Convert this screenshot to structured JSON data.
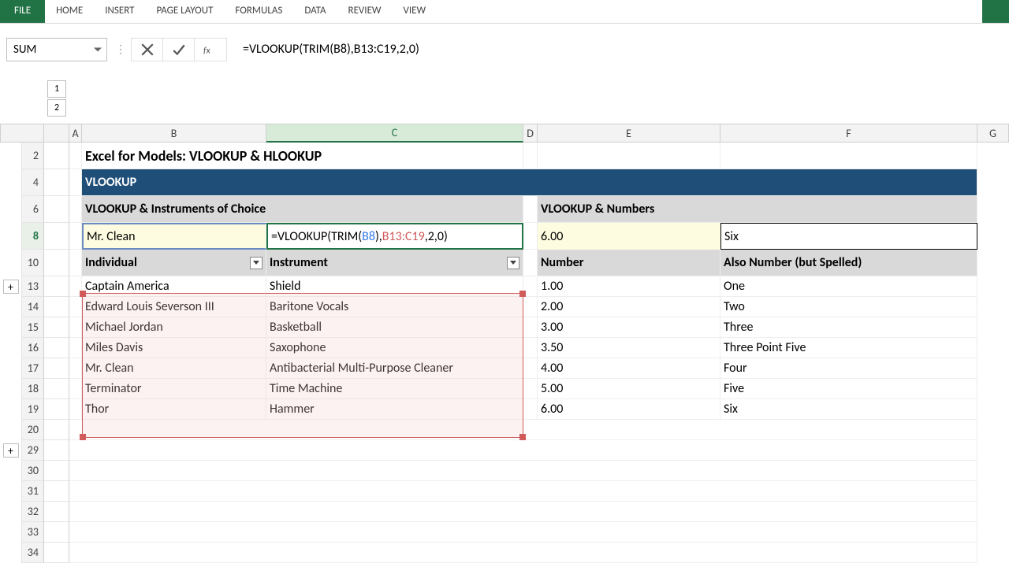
{
  "ribbon": {
    "file": "FILE",
    "tabs": [
      "HOME",
      "INSERT",
      "PAGE LAYOUT",
      "FORMULAS",
      "DATA",
      "REVIEW",
      "VIEW"
    ]
  },
  "namebox": "SUM",
  "formula_bar": "=VLOOKUP(TRIM(B8),B13:C19,2,0)",
  "outline_levels_row": [
    "1",
    "2"
  ],
  "outline_levels_col": [
    "1",
    "2"
  ],
  "columns": [
    "A",
    "B",
    "C",
    "D",
    "E",
    "F",
    "G"
  ],
  "active_column": "C",
  "rows_visible": [
    "2",
    "4",
    "6",
    "8",
    "10",
    "13",
    "14",
    "15",
    "16",
    "17",
    "18",
    "19",
    "20",
    "29",
    "30",
    "31",
    "32",
    "33",
    "34"
  ],
  "active_row": "8",
  "content": {
    "title": "Excel for Models: VLOOKUP & HLOOKUP",
    "section_header": "VLOOKUP",
    "left_sub_header": "VLOOKUP & Instruments of Choice",
    "right_sub_header": "VLOOKUP & Numbers",
    "lookup_left_input": "Mr. Clean",
    "editing_formula": {
      "p1": "=VLOOKUP(TRIM(",
      "p2": "B8",
      "p3": "),",
      "p4": "B13:C19",
      "p5": ",2,0)"
    },
    "lookup_right_input": "6.00",
    "lookup_right_result": "Six",
    "left_headers": [
      "Individual",
      "Instrument"
    ],
    "right_headers": [
      "Number",
      "Also Number (but Spelled)"
    ],
    "left_table": [
      {
        "individual": "Captain America",
        "instrument": "Shield"
      },
      {
        "individual": "Edward Louis Severson III",
        "instrument": "Baritone Vocals"
      },
      {
        "individual": "Michael Jordan",
        "instrument": "Basketball"
      },
      {
        "individual": "Miles Davis",
        "instrument": "Saxophone"
      },
      {
        "individual": "Mr. Clean",
        "instrument": "Antibacterial Multi-Purpose Cleaner"
      },
      {
        "individual": "Terminator",
        "instrument": "Time Machine"
      },
      {
        "individual": "Thor",
        "instrument": "Hammer"
      }
    ],
    "right_table": [
      {
        "number": "1.00",
        "spelled": "One"
      },
      {
        "number": "2.00",
        "spelled": "Two"
      },
      {
        "number": "3.00",
        "spelled": "Three"
      },
      {
        "number": "3.50",
        "spelled": "Three Point Five"
      },
      {
        "number": "4.00",
        "spelled": "Four"
      },
      {
        "number": "5.00",
        "spelled": "Five"
      },
      {
        "number": "6.00",
        "spelled": "Six"
      }
    ]
  }
}
